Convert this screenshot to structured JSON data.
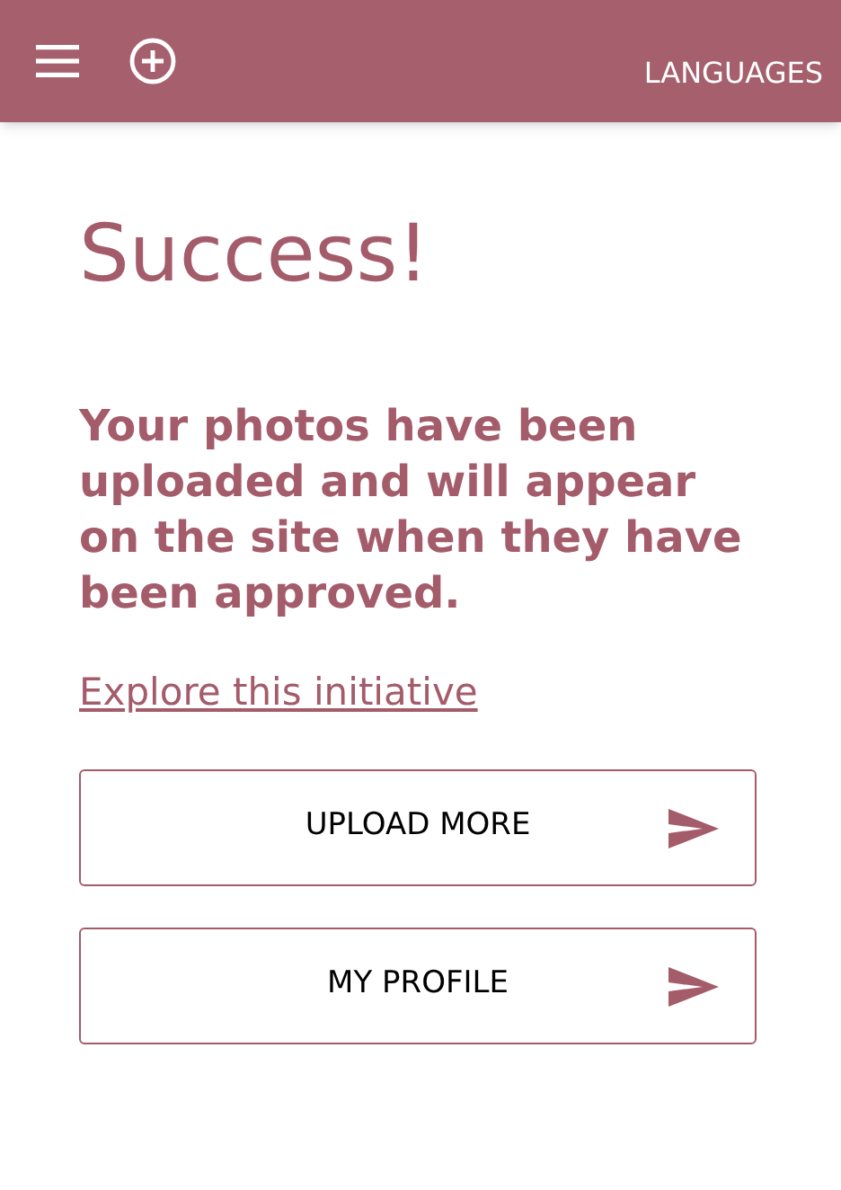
{
  "header": {
    "languages_link": "LANGUAGES"
  },
  "title": "Success!",
  "message": "Your photos have been uploaded and will appear on the site when they have been approved.",
  "link": "Explore this initiative",
  "buttons": [
    {
      "label": "UPLOAD MORE"
    },
    {
      "label": "MY PROFILE"
    }
  ]
}
